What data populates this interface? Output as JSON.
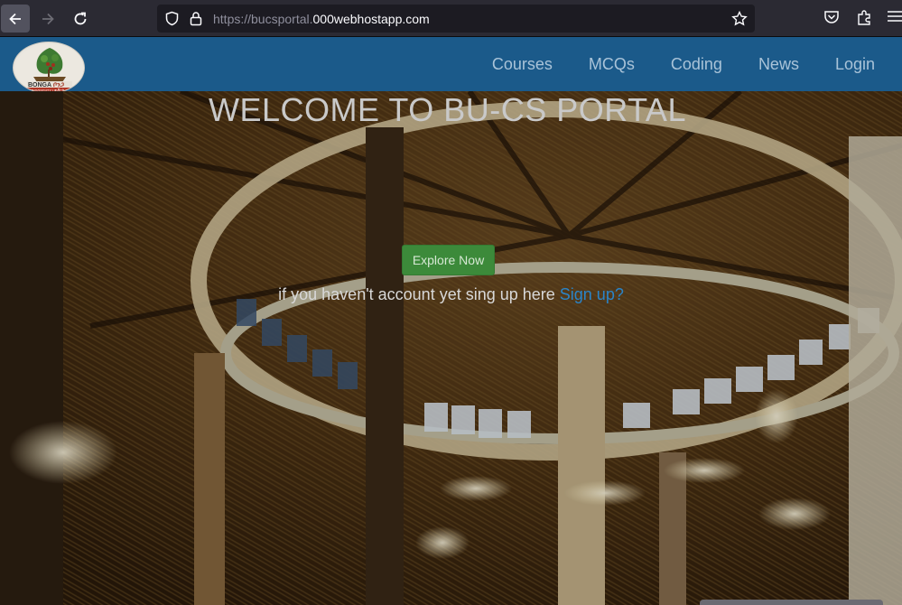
{
  "browser": {
    "url_prefix": "https://bucsportal.",
    "url_host": "000webhostapp.com"
  },
  "site": {
    "logo_text": "BONGA UNIVERSITY",
    "nav": [
      "Courses",
      "MCQs",
      "Coding",
      "News",
      "Login"
    ]
  },
  "hero": {
    "title": "WELCOME TO BU-CS PORTAL",
    "explore_label": "Explore Now",
    "signup_text": "if you haven't account yet sing up here ",
    "signup_link": "Sign up?"
  },
  "colors": {
    "header": "#1b5a8a",
    "explore_button": "#3c8a3a",
    "link": "#2a84c8"
  }
}
